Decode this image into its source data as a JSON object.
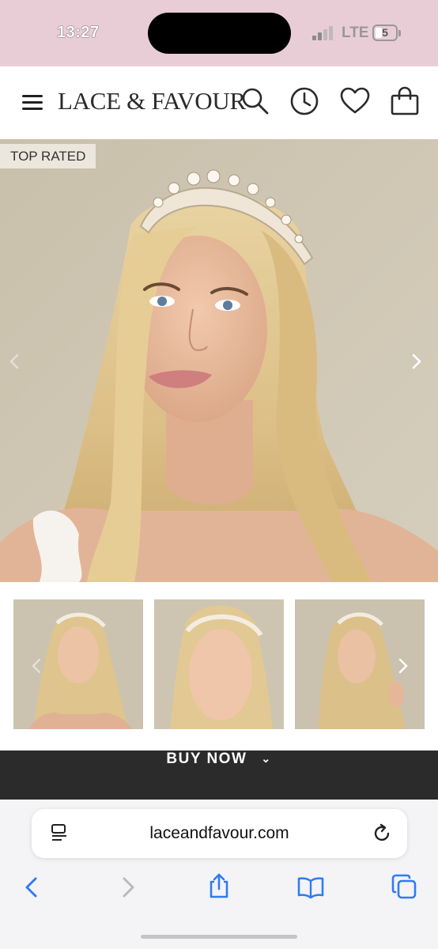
{
  "status_bar": {
    "time": "13:27",
    "network": "LTE",
    "battery": "5"
  },
  "header": {
    "logo": "LACE & FAVOUR"
  },
  "hero": {
    "badge": "TOP RATED"
  },
  "buy": {
    "label": "BUY NOW",
    "chevron": "⌄"
  },
  "browser": {
    "url": "laceandfavour.com"
  },
  "colors": {
    "status_bg": "#e9cdd6",
    "buy_bg": "#2b2b2b",
    "ios_blue": "#2f7bf5"
  }
}
